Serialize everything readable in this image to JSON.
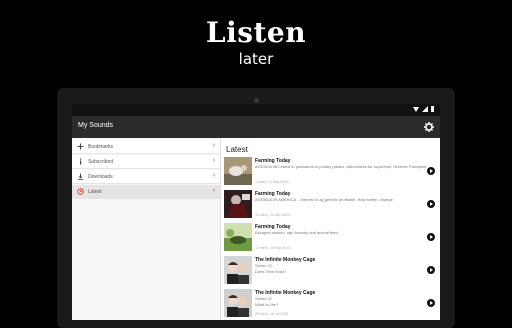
{
  "promo": {
    "title": "Listen",
    "subtitle": "later"
  },
  "app": {
    "title": "My Sounds"
  },
  "sidebar": {
    "items": [
      {
        "label": "Bookmarks",
        "icon": "plus-icon"
      },
      {
        "label": "Subscribed",
        "icon": "info-icon"
      },
      {
        "label": "Downloads",
        "icon": "download-icon"
      },
      {
        "label": "Latest",
        "icon": "clock-icon",
        "active": true
      }
    ]
  },
  "main": {
    "title": "Latest",
    "items": [
      {
        "title": "Farming Today",
        "desc": "AGENDA 08 Linked to pollinators in poultry pastes, alternatives for soya feed, Greener Farmyard",
        "desc2": "",
        "meta": "4 mins | 21 Sep 06:01"
      },
      {
        "title": "Farming Today",
        "desc": "AGENDA 09 AMERICA ...Interest in ag genetic profitable, Raw sheep, change",
        "desc2": "",
        "meta": "13 mins | 20 Sep 06:01"
      },
      {
        "title": "Farming Today",
        "desc": "Escaped salmon, agri-forestry and animal feed",
        "desc2": "",
        "meta": "13 mins | 19 Sep 06:01"
      },
      {
        "title": "The Infinite Monkey Cage",
        "desc": "Series 22",
        "desc2": "Does Time Exist?",
        "meta": ""
      },
      {
        "title": "The Infinite Monkey Cage",
        "desc": "Series 22",
        "desc2": "What is Life?",
        "meta": "28 mins | 19 Jul 2020"
      }
    ]
  },
  "colors": {
    "accent": "#e8332c",
    "appbar": "#2b2b2b"
  }
}
